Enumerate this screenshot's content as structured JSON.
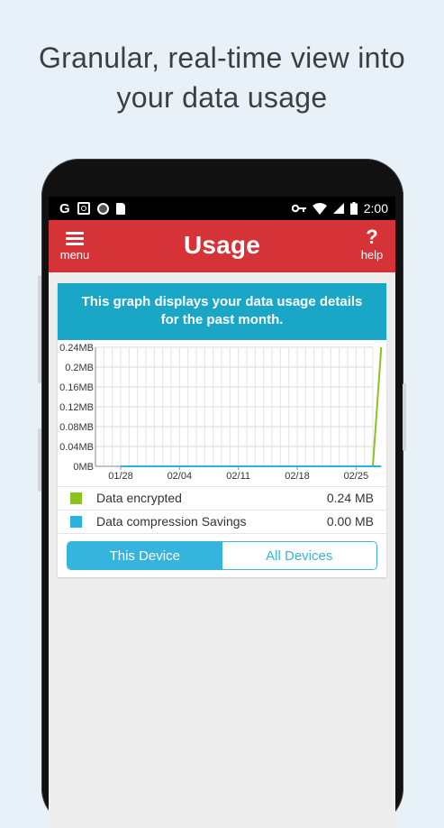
{
  "headline": {
    "line1": "Granular, real-time view into",
    "line2": "your data usage"
  },
  "status_bar": {
    "time": "2:00",
    "g_label": "G"
  },
  "app_bar": {
    "title": "Usage",
    "menu_label": "menu",
    "help_label": "help",
    "help_symbol": "?"
  },
  "banner": {
    "line1": "This graph displays your data usage details",
    "line2": "for the past month."
  },
  "chart_data": {
    "type": "line",
    "y_tick_labels": [
      "0.24MB",
      "0.2MB",
      "0.16MB",
      "0.12MB",
      "0.08MB",
      "0.04MB",
      "0MB"
    ],
    "y_ticks": [
      0.24,
      0.2,
      0.16,
      0.12,
      0.08,
      0.04,
      0
    ],
    "x_tick_labels": [
      "01/28",
      "02/04",
      "02/11",
      "02/18",
      "02/25"
    ],
    "ylim": [
      0,
      0.24
    ],
    "grid": true,
    "series": [
      {
        "name": "Data encrypted",
        "color": "#8dc21f",
        "x": [
          "01/28",
          "02/04",
          "02/11",
          "02/18",
          "02/25",
          "02/26",
          "02/27",
          "02/28"
        ],
        "values": [
          0,
          0,
          0,
          0,
          0,
          0,
          0,
          0.24
        ]
      },
      {
        "name": "Data compression Savings",
        "color": "#29b3dd",
        "x": [
          "01/28",
          "02/04",
          "02/11",
          "02/18",
          "02/25",
          "02/26",
          "02/27",
          "02/28"
        ],
        "values": [
          0,
          0,
          0,
          0,
          0,
          0,
          0,
          0
        ]
      }
    ]
  },
  "legend": [
    {
      "label": "Data encrypted",
      "value": "0.24 MB",
      "color": "#8dc21f"
    },
    {
      "label": "Data compression Savings",
      "value": "0.00 MB",
      "color": "#29b3dd"
    }
  ],
  "toggle": {
    "this_device": "This Device",
    "all_devices": "All Devices",
    "selected": "This Device"
  },
  "colors": {
    "app_bar": "#d53337",
    "banner": "#1aa6c7",
    "accent": "#35b4dd"
  }
}
